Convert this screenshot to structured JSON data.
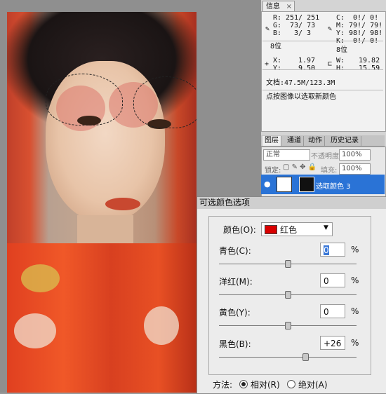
{
  "info_panel": {
    "tab_label": "信息",
    "close_glyph": "×",
    "rgb": {
      "r_label": "R:",
      "r_value": "251/ 251",
      "g_label": "G:",
      "g_value": "73/ 73",
      "b_label": "B:",
      "b_value": "3/ 3"
    },
    "cmyk": {
      "c_label": "C:",
      "c_value": "0!/ 0!",
      "m_label": "M:",
      "m_value": "79!/ 79!",
      "y_label": "Y:",
      "y_value": "98!/ 98!",
      "k_label": "K:",
      "k_value": "0!/ 0!"
    },
    "bits_left": "8位",
    "bits_right": "8位",
    "pos": {
      "x_label": "X:",
      "x_value": "1.97",
      "y_label": "Y:",
      "y_value": "9.50"
    },
    "size": {
      "w_label": "W:",
      "w_value": "19.82",
      "h_label": "H:",
      "h_value": "15.59"
    },
    "doc_size": "文档:47.5M/123.3M",
    "hint": "点按图像以选取新颜色"
  },
  "layers_panel": {
    "tabs": [
      "图层",
      "通道",
      "动作",
      "历史记录"
    ],
    "blend_mode": "正常",
    "opacity_label": "不透明度:",
    "opacity_value": "100%",
    "lock_label": "锁定:",
    "fill_label": "填充:",
    "fill_value": "100%",
    "layer_name": "选取颜色 3"
  },
  "dialog": {
    "title": "可选颜色选项",
    "color_label": "颜色(O):",
    "color_value": "红色",
    "color_hex": "#d90000",
    "sliders": [
      {
        "label": "青色(C):",
        "value": "0",
        "pct": "%",
        "level": 0
      },
      {
        "label": "洋红(M):",
        "value": "0",
        "pct": "%",
        "level": 0
      },
      {
        "label": "黄色(Y):",
        "value": "0",
        "pct": "%",
        "level": 0
      },
      {
        "label": "黑色(B):",
        "value": "+26",
        "pct": "%",
        "level": 26
      }
    ],
    "method_label": "方法:",
    "method_relative": "相对(R)",
    "method_absolute": "绝对(A)"
  }
}
